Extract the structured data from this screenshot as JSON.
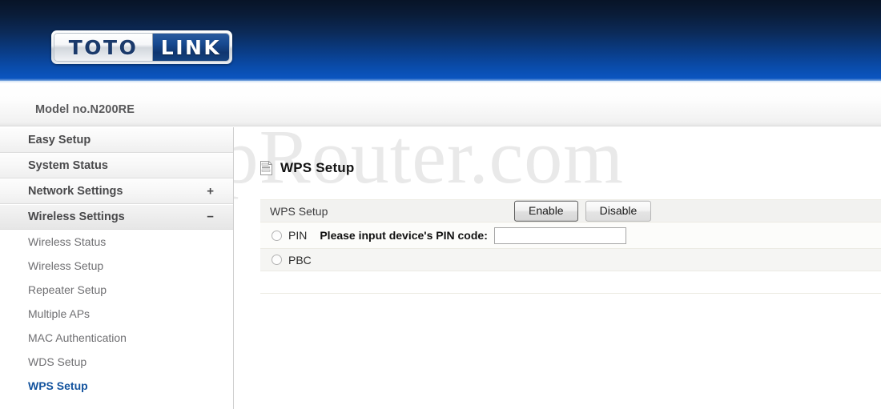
{
  "brand": {
    "logo_left": "TOTO",
    "logo_right": "LINK",
    "model_label": "Model no.N200RE"
  },
  "watermark": {
    "text": "SetupRouter.com"
  },
  "sidebar": {
    "top_items": [
      {
        "label": "Easy Setup",
        "toggle": "",
        "active": false
      },
      {
        "label": "System Status",
        "toggle": "",
        "active": false
      },
      {
        "label": "Network Settings",
        "toggle": "+",
        "active": false
      },
      {
        "label": "Wireless Settings",
        "toggle": "−",
        "active": true
      }
    ],
    "sub_items": [
      {
        "label": "Wireless Status",
        "active": false
      },
      {
        "label": "Wireless Setup",
        "active": false
      },
      {
        "label": "Repeater Setup",
        "active": false
      },
      {
        "label": "Multiple APs",
        "active": false
      },
      {
        "label": "MAC Authentication",
        "active": false
      },
      {
        "label": "WDS Setup",
        "active": false
      },
      {
        "label": "WPS Setup",
        "active": true
      }
    ]
  },
  "content": {
    "page_title": "WPS Setup",
    "page_icon": "document-list-icon",
    "table": {
      "row_label": "WPS Setup",
      "enable_button": "Enable",
      "disable_button": "Disable",
      "pin_radio_label": "PIN",
      "pin_prompt": "Please input device's PIN code:",
      "pin_value": "",
      "pin_placeholder": "",
      "pbc_radio_label": "PBC"
    }
  },
  "colors": {
    "header_top": "#081427",
    "header_bottom": "#0b55c0",
    "active_link": "#13539e",
    "watermark": "#e9e9e9",
    "row_header_bg": "#f2f2f0"
  }
}
